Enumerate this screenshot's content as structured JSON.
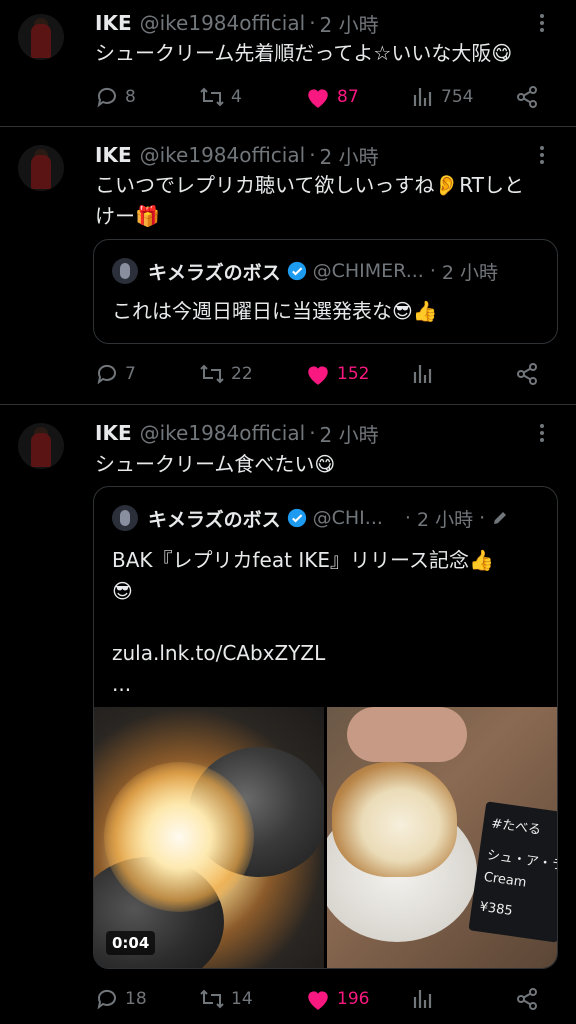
{
  "tweets": [
    {
      "name": "IKE",
      "handle": "@ike1984official",
      "time": "2 小時",
      "text": "シュークリーム先着順だってよ☆いいな大阪😋",
      "replies": "8",
      "retweets": "4",
      "likes": "87",
      "views": "754"
    },
    {
      "name": "IKE",
      "handle": "@ike1984official",
      "time": "2 小時",
      "text_line1": "こいつでレプリカ聴いて欲しいっすね👂RTしと",
      "text_line2": "けー🎁",
      "quote": {
        "name": "キメラズのボス",
        "handle": "@CHIMER...",
        "time": "2 小時",
        "text": "これは今週日曜日に当選発表な😎👍"
      },
      "replies": "7",
      "retweets": "22",
      "likes": "152"
    },
    {
      "name": "IKE",
      "handle": "@ike1984official",
      "time": "2 小時",
      "text": "シュークリーム食べたい😋",
      "quote": {
        "name": "キメラズのボス",
        "handle": "@CHI...",
        "time": "2 小時",
        "text_line1": "BAK『レプリカfeat IKE』リリース記念👍",
        "text_line2": "😎",
        "link": "zula.lnk.to/CAbxZYZL",
        "ellipsis": "...",
        "video_duration": "0:04",
        "sign_line1": "#たべる",
        "sign_line2": "シュ・ア・ラ",
        "sign_line3": "Cream",
        "sign_line4": "¥385"
      },
      "replies": "18",
      "retweets": "14",
      "likes": "196"
    }
  ],
  "colors": {
    "background": "#000000",
    "text": "#e7e9ea",
    "muted": "#71767b",
    "like": "#f91880",
    "verified": "#1d9bf0",
    "border": "#2f3336"
  },
  "icons": [
    "reply-icon",
    "retweet-icon",
    "heart-icon",
    "views-icon",
    "share-icon",
    "more-icon",
    "verified-badge-icon",
    "edit-icon"
  ]
}
